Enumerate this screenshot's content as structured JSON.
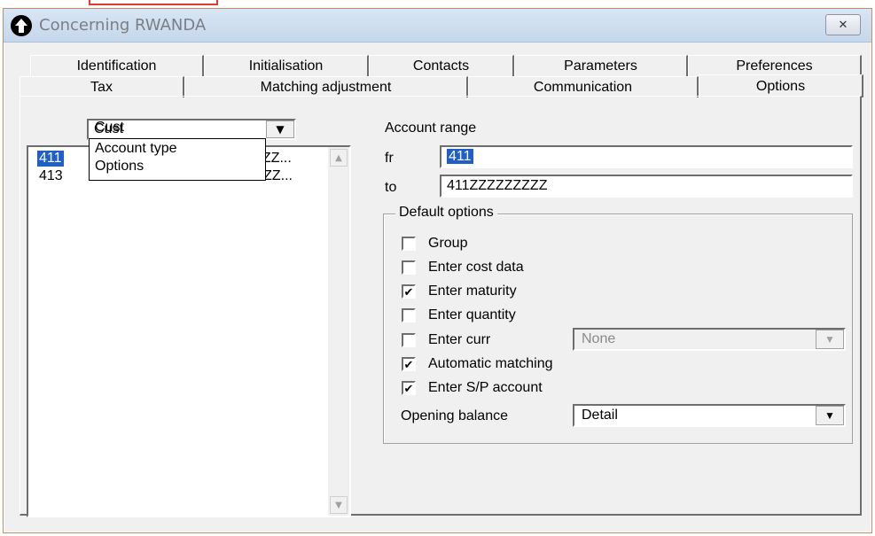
{
  "window": {
    "title": "Concerning RWANDA",
    "close_glyph": "✕"
  },
  "tabs_back": [
    "Identification",
    "Initialisation",
    "Contacts",
    "Parameters",
    "Preferences"
  ],
  "tabs_front": [
    "Tax",
    "Matching adjustment",
    "Communication",
    "Options"
  ],
  "active_tab": "Options",
  "filter_dropdown": {
    "selected": "Cust",
    "options": [
      "Cust",
      "Account type",
      "Options"
    ]
  },
  "account_list": {
    "rows": [
      {
        "code": "411",
        "range": "411ZZZZZZZZZ..."
      },
      {
        "code": "413",
        "range": "413ZZZZZZZZZ..."
      }
    ],
    "selected_index": 0
  },
  "account_range": {
    "label": "Account range",
    "from_label": "fr",
    "from_value": "411",
    "to_label": "to",
    "to_value": "411ZZZZZZZZZ"
  },
  "default_options": {
    "title": "Default options",
    "items": [
      {
        "label": "Group",
        "checked": false
      },
      {
        "label": "Enter cost data",
        "checked": false
      },
      {
        "label": "Enter maturity",
        "checked": true
      },
      {
        "label": "Enter quantity",
        "checked": false
      },
      {
        "label": "Enter curr",
        "checked": false
      },
      {
        "label": "Automatic matching",
        "checked": true
      },
      {
        "label": "Enter S/P account",
        "checked": true
      }
    ],
    "currency_value": "None",
    "opening_balance_label": "Opening balance",
    "opening_balance_value": "Detail"
  },
  "colors": {
    "selection": "#1f5fc6",
    "titlebar": "#c5d7eb"
  }
}
